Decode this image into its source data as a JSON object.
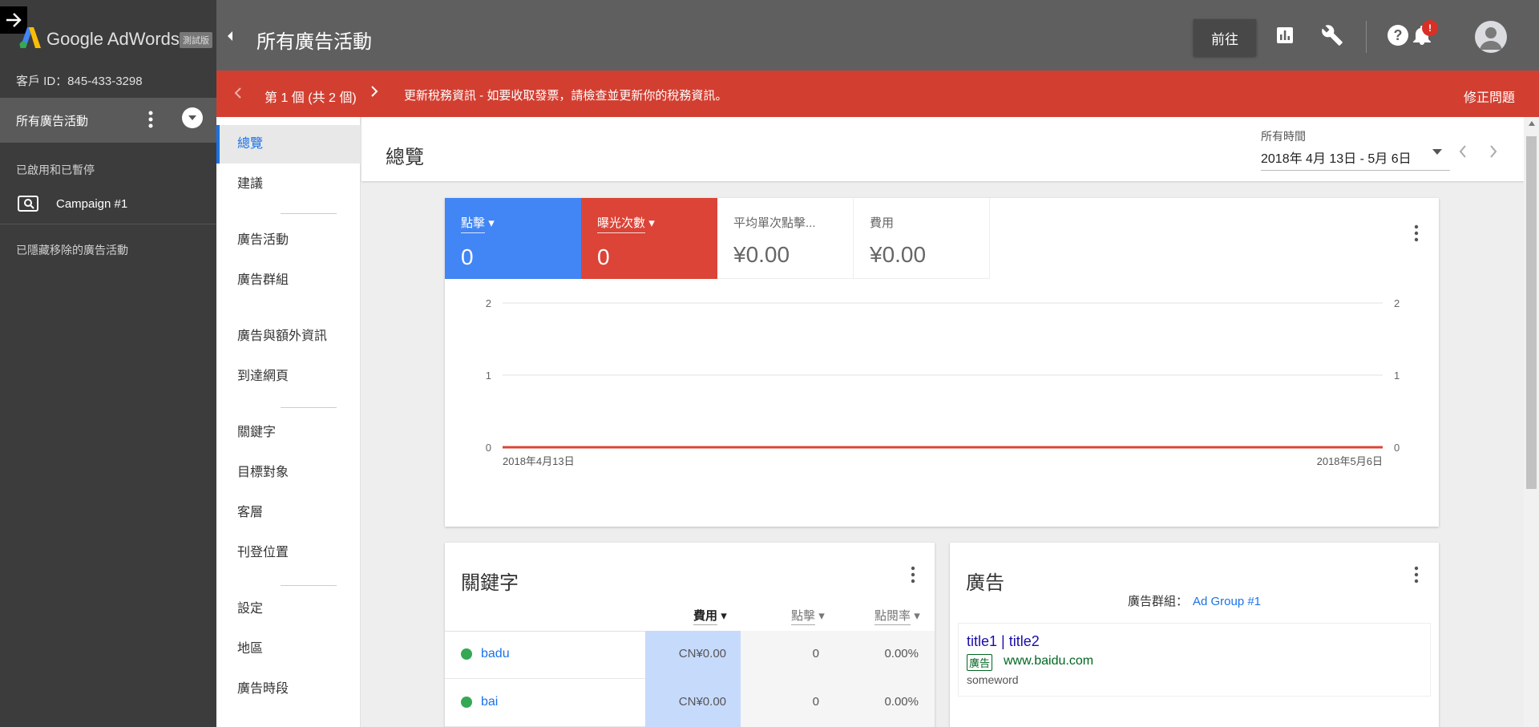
{
  "sidebar": {
    "brand": "Google AdWords",
    "beta_badge": "測試版",
    "customer_id": "客戶 ID：845-433-3298",
    "all_campaigns": "所有廣告活動",
    "enabled_paused": "已啟用和已暫停",
    "campaign_name": "Campaign #1",
    "hidden_removed": "已隱藏移除的廣告活動"
  },
  "header": {
    "title": "所有廣告活動",
    "goto_label": "前往",
    "notification_count": "!"
  },
  "banner": {
    "count": "第 1 個 (共 2 個)",
    "message": "更新稅務資訊 - 如要收取發票，請檢查並更新你的稅務資訊。",
    "fix": "修正問題"
  },
  "subnav": {
    "items": [
      "總覽",
      "建議",
      "廣告活動",
      "廣告群組",
      "廣告與額外資訊",
      "到達網頁",
      "關鍵字",
      "目標對象",
      "客層",
      "刊登位置",
      "設定",
      "地區",
      "廣告時段"
    ]
  },
  "overview": {
    "title": "總覽",
    "date_label": "所有時間",
    "date_value": "2018年 4月 13日 - 5月 6日"
  },
  "metrics": [
    {
      "label": "點擊",
      "value": "0",
      "color": "#4285f4"
    },
    {
      "label": "曝光次數",
      "value": "0",
      "color": "#db4437"
    },
    {
      "label": "平均單次點擊...",
      "value": "¥0.00"
    },
    {
      "label": "費用",
      "value": "¥0.00"
    }
  ],
  "chart_data": {
    "type": "line",
    "x": [
      "2018年4月13日",
      "2018年5月6日"
    ],
    "series": [
      {
        "values": [
          0,
          0
        ],
        "color": "#db4437"
      },
      {
        "values": [
          0,
          0
        ],
        "color": "#4285f4"
      }
    ],
    "ylim": [
      0,
      2
    ],
    "yticks": [
      "0",
      "1",
      "2"
    ],
    "grid": true
  },
  "keywords": {
    "title": "關鍵字",
    "col_cost": "費用",
    "col_clicks": "點擊",
    "col_ctr": "點閱率",
    "rows": [
      {
        "name": "badu",
        "cost": "CN¥0.00",
        "clicks": "0",
        "ctr": "0.00%"
      },
      {
        "name": "bai",
        "cost": "CN¥0.00",
        "clicks": "0",
        "ctr": "0.00%"
      }
    ]
  },
  "ads": {
    "title": "廣告",
    "group_label": "廣告群組：",
    "group_name": "Ad Group #1",
    "headline": "title1 | title2",
    "badge": "廣告",
    "url": "www.baidu.com",
    "description": "someword"
  }
}
